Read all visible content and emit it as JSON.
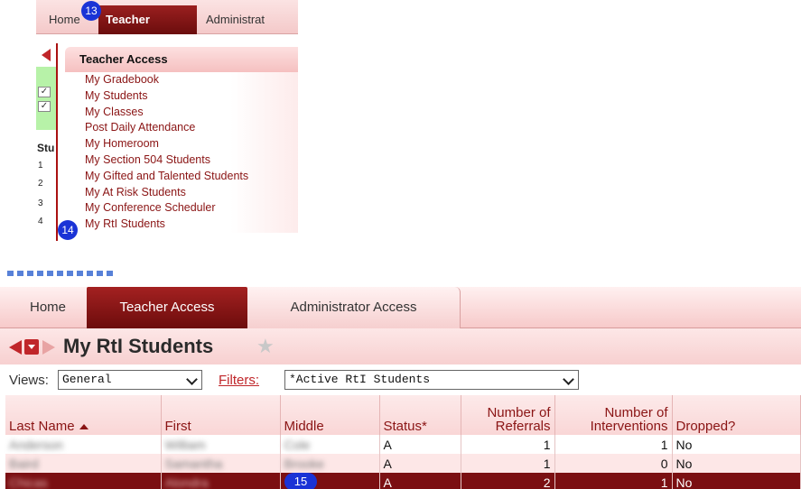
{
  "top": {
    "tabs": {
      "home": "Home",
      "teacher": "Teacher Access",
      "admin": "Administrat"
    },
    "badges": {
      "b1": "13",
      "b2": "14"
    },
    "bg_column_header": "Stu",
    "bg_row_numbers": [
      "1",
      "2",
      "3",
      "4"
    ],
    "menu": {
      "title": "Teacher Access",
      "items": [
        "My Gradebook",
        "My Students",
        "My Classes",
        "Post Daily Attendance",
        "My Homeroom",
        "My Section 504 Students",
        "My Gifted and Talented Students",
        "My At Risk Students",
        "My Conference Scheduler",
        "My RtI Students"
      ]
    }
  },
  "bottom": {
    "tabs": {
      "home": "Home",
      "teacher": "Teacher Access",
      "admin": "Administrator Access"
    },
    "page_title": "My RtI Students",
    "views_label": "Views:",
    "views_value": "General",
    "filters_label": "Filters:",
    "filters_value": "*Active RtI Students",
    "badge": "15",
    "table": {
      "headers": {
        "last": "Last Name",
        "first": "First",
        "middle": "Middle",
        "status": "Status*",
        "referrals_1": "Number of",
        "referrals_2": "Referrals",
        "interventions_1": "Number of",
        "interventions_2": "Interventions",
        "dropped": "Dropped?"
      },
      "rows": [
        {
          "last": "Anderson",
          "first": "William",
          "middle": "Cole",
          "status": "A",
          "referrals": "1",
          "interventions": "1",
          "dropped": "No"
        },
        {
          "last": "Baird",
          "first": "Samantha",
          "middle": "Brooke",
          "status": "A",
          "referrals": "1",
          "interventions": "0",
          "dropped": "No"
        },
        {
          "last": "Chicas",
          "first": "Alondra",
          "middle": "",
          "status": "A",
          "referrals": "2",
          "interventions": "1",
          "dropped": "No"
        }
      ]
    }
  },
  "colors": {
    "accent_dark_red": "#7b0f12",
    "tab_active": "#a42121",
    "link_red": "#8a1414",
    "badge_blue": "#1a33d6"
  },
  "icons": {
    "favorite": "star-icon",
    "nav_prev": "arrow-left-icon",
    "nav_menu": "dropdown-icon",
    "nav_next": "arrow-right-icon",
    "sort": "sort-ascending-icon"
  }
}
